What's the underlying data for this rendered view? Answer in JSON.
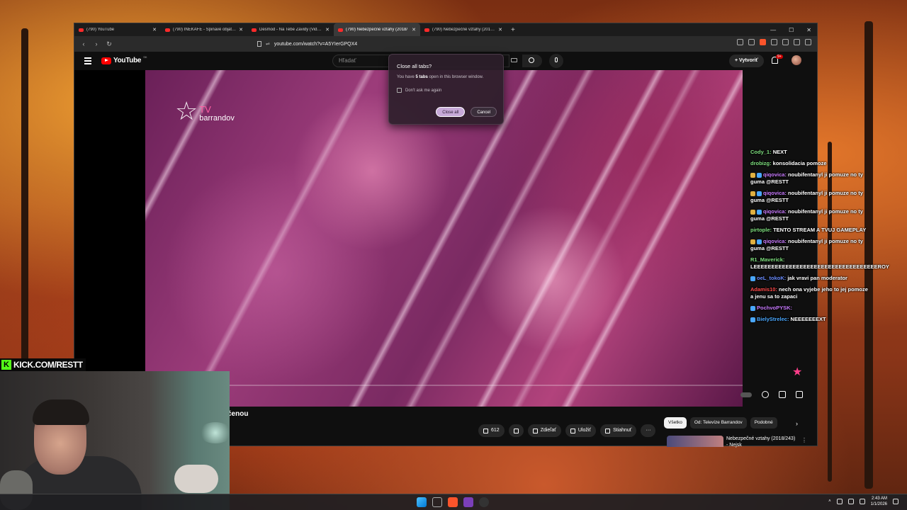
{
  "browser": {
    "tabs": [
      {
        "title": "(790) YouTube",
        "active": false
      },
      {
        "title": "(790) INEKAFE - Špinavé objatie - Yo",
        "active": false
      },
      {
        "title": "Desmod - Na Tebe Zavidy (Video) - Y",
        "active": false
      },
      {
        "title": "(790) Nebezpečné vztahy (2018/",
        "active": true
      },
      {
        "title": "(790) Nebezpečné vztahy (2019/258",
        "active": false
      }
    ],
    "new_tab": "+",
    "url": "youtube.com/watch?v=A5YIerGPQX4",
    "window_controls": {
      "minimize": "—",
      "maximize": "☐",
      "close": "✕"
    }
  },
  "youtube": {
    "logo_text": "YouTube",
    "region": "SK",
    "search_placeholder": "Hľadať",
    "create_label": "Vytvoriť",
    "notification_count": "9+",
    "video": {
      "channel_logo_tv": "TV",
      "channel_logo_name": "barrandov",
      "title_fragment": "čenou"
    },
    "actions": {
      "like_count": "612",
      "share": "Zdieľať",
      "save": "Uložiť",
      "download": "Stiahnuť",
      "more": "···"
    },
    "chips": [
      "Všetko",
      "Od: Televíze Barrandov",
      "Podobné"
    ],
    "chip_next": "›",
    "recommendation": {
      "title": "Nebezpečné vztahy (2018/243) - Nejsk",
      "menu": "⋮"
    }
  },
  "dialog": {
    "title": "Close all tabs?",
    "message_prefix": "You have ",
    "message_count": "5 tabs",
    "message_suffix": " open in this browser window.",
    "checkbox_label": "Don't ask me again",
    "confirm_label": "Close all",
    "cancel_label": "Cancel"
  },
  "chat": [
    {
      "user": "Cody_1:",
      "text": "NEXT",
      "color": "#7ee07e",
      "badges": []
    },
    {
      "user": "drobizg:",
      "text": "konsolidacia pomoze",
      "color": "#7ee07e",
      "badges": []
    },
    {
      "user": "qiqovica:",
      "text": "noubifentanyl ji pomuze no ty guma @RESTT",
      "color": "#c97bff",
      "badges": [
        "#e0b040",
        "#4aa8ff"
      ]
    },
    {
      "user": "qiqovica:",
      "text": "noubifentanyl ji pomuze no ty guma @RESTT",
      "color": "#c97bff",
      "badges": [
        "#e0b040",
        "#4aa8ff"
      ]
    },
    {
      "user": "qiqovica:",
      "text": "noubifentanyl ji pomuze no ty guma @RESTT",
      "color": "#c97bff",
      "badges": [
        "#e0b040",
        "#4aa8ff"
      ]
    },
    {
      "user": "pirtople:",
      "text": "TENTO STREAM A TVUJ GAMEPLAY",
      "color": "#7ee07e",
      "badges": []
    },
    {
      "user": "qiqovica:",
      "text": "noubifentanyl ji pomuze no ty guma @RESTT",
      "color": "#c97bff",
      "badges": [
        "#e0b040",
        "#4aa8ff"
      ]
    },
    {
      "user": "R1_Maverick:",
      "text": "LEEEEEEEEEEEEEEEEEEEEEEEEEEEEEEEEEEEROY",
      "color": "#7ee07e",
      "badges": []
    },
    {
      "user": "oeL_tokoK:",
      "text": "jak vravi pan moderator",
      "color": "#6a8cff",
      "badges": [
        "#4aa8ff"
      ]
    },
    {
      "user": "Adamis10:",
      "text": "nech ona vyjebe jeho to jej pomoze a jenu sa to zapaci",
      "color": "#ff4a4a",
      "badges": []
    },
    {
      "user": "PochvoPYSK:",
      "text": "",
      "color": "#c97bff",
      "badges": [
        "#4aa8ff"
      ]
    },
    {
      "user": "BielyStrelec:",
      "text": "NEEEEEEEXT",
      "color": "#4aa8ff",
      "badges": [
        "#4aa8ff"
      ]
    }
  ],
  "stream": {
    "kick_k": "K",
    "kick_url": "KICK.COM/RESTT"
  },
  "taskbar": {
    "time": "2:43 AM",
    "date": "1/1/2026"
  },
  "colors": {
    "youtube_red": "#ff0000",
    "kick_green": "#53fc18",
    "dialog_primary": "#c7a9d8"
  }
}
